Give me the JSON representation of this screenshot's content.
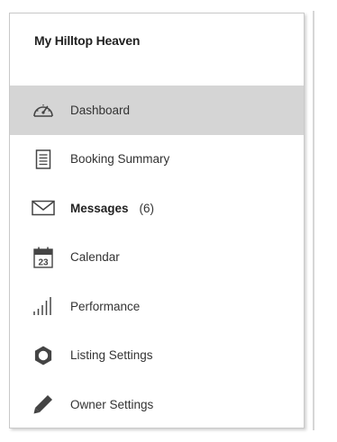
{
  "sidebar": {
    "title": "My Hilltop Heaven",
    "items": [
      {
        "label": "Dashboard",
        "icon": "speedometer-icon",
        "active": true
      },
      {
        "label": "Booking Summary",
        "icon": "document-icon",
        "active": false
      },
      {
        "label": "Messages",
        "icon": "envelope-icon",
        "active": false,
        "count": "(6)"
      },
      {
        "label": "Calendar",
        "icon": "calendar-icon",
        "active": false,
        "date": "23"
      },
      {
        "label": "Performance",
        "icon": "bar-chart-icon",
        "active": false
      },
      {
        "label": "Listing Settings",
        "icon": "gear-icon",
        "active": false
      },
      {
        "label": "Owner Settings",
        "icon": "pencil-icon",
        "active": false
      }
    ]
  },
  "colors": {
    "active_background": "#d5d5d5",
    "icon": "#444444",
    "text": "#333333"
  }
}
